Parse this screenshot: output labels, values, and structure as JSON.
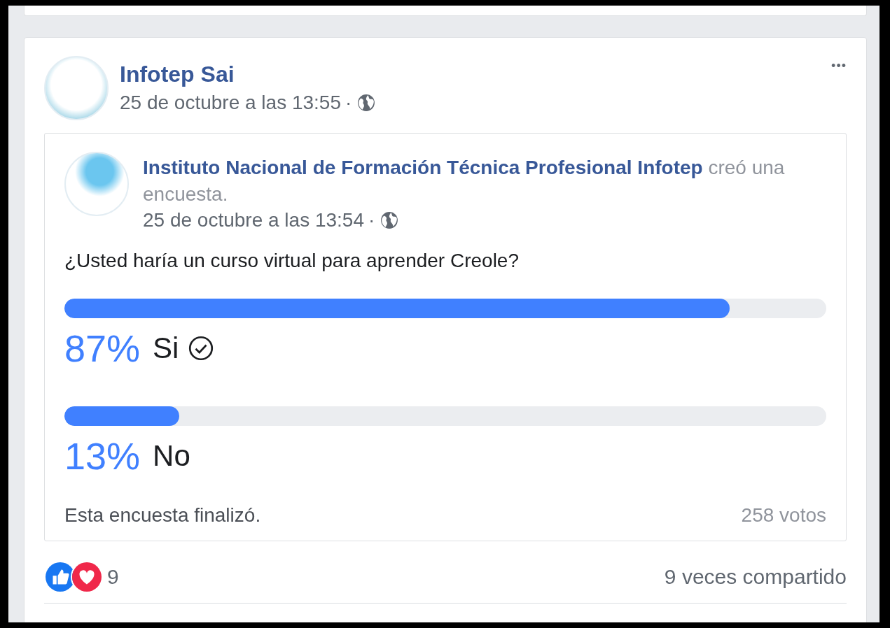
{
  "post": {
    "author": "Infotep Sai",
    "time": "25 de octubre a las 13:55",
    "separator": "·",
    "more": "•••",
    "shared": {
      "author": "Instituto Nacional de Formación Técnica Profesional Infotep",
      "action": "creó una encuesta.",
      "time": "25 de octubre a las 13:54",
      "separator": "·",
      "poll": {
        "question": "¿Usted haría un curso virtual para aprender Creole?",
        "options": [
          {
            "percent": "87%",
            "label": "Si",
            "level": 0.873,
            "selected": true
          },
          {
            "percent": "13%",
            "label": "No",
            "level": 0.151,
            "selected": false
          }
        ],
        "status": "Esta encuesta finalizó.",
        "votes": "258 votos"
      }
    },
    "reactions": {
      "count": "9",
      "shares": "9 veces compartido"
    }
  }
}
